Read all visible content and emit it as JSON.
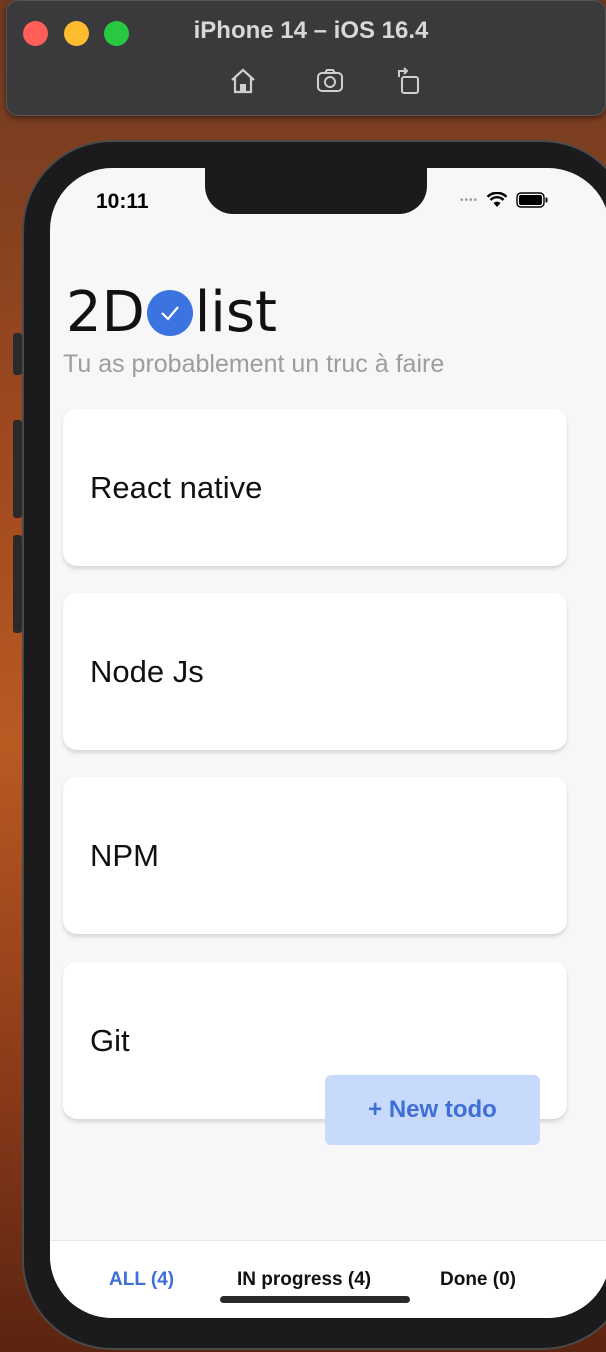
{
  "simulator": {
    "title": "iPhone 14 – iOS 16.4",
    "tools": [
      "home-icon",
      "screenshot-icon",
      "rotate-icon"
    ]
  },
  "status_bar": {
    "time": "10:11",
    "icons": [
      "signal-dots-icon",
      "wifi-icon",
      "battery-icon"
    ]
  },
  "app": {
    "logo_left": "2D",
    "logo_right": "list",
    "subtitle": "Tu as probablement un truc à faire",
    "accent_color": "#3b73e0"
  },
  "todos": [
    {
      "label": "React native"
    },
    {
      "label": "Node Js"
    },
    {
      "label": "NPM"
    },
    {
      "label": "Git"
    }
  ],
  "new_todo_button": "+ New todo",
  "tabs": [
    {
      "label": "ALL (4)",
      "active": true
    },
    {
      "label": "IN progress (4)",
      "active": false
    },
    {
      "label": "Done (0)",
      "active": false
    }
  ]
}
